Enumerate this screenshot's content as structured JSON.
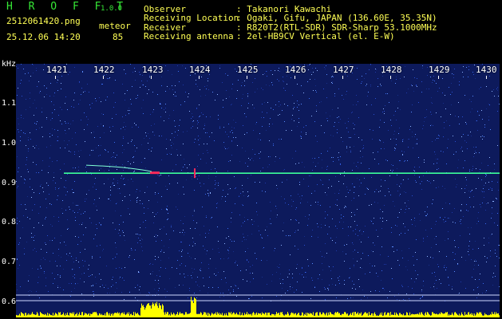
{
  "app": {
    "brand": "H R O F F T",
    "version": "1.0.0",
    "filename": "2512061420.png",
    "datetime": "25.12.06 14:20",
    "meteor_label": "meteor",
    "meteor_count": "85"
  },
  "info": [
    {
      "key": "Observer",
      "value": ": Takanori Kawachi"
    },
    {
      "key": "Receiving Location",
      "value": ": Ogaki, Gifu, JAPAN (136.60E, 35.35N)"
    },
    {
      "key": "Receiver",
      "value": ": R820T2(RTL-SDR) SDR-Sharp 53.1000MHz"
    },
    {
      "key": "Receiving antenna",
      "value": ": 2el-HB9CV Vertical (el. E-W)"
    }
  ],
  "spectrogram": {
    "y_unit": "kHz",
    "x_ticks": [
      "1421",
      "1422",
      "1423",
      "1424",
      "1425",
      "1426",
      "1427",
      "1428",
      "1429",
      "1430"
    ],
    "y_ticks": [
      "1.1",
      "1.0",
      "0.9",
      "0.8",
      "0.7",
      "0.6"
    ],
    "carrier_khz": 0.925,
    "colors": {
      "background": "#0d1a5c",
      "carrier": "#3cff9a",
      "echo": "#ff2a5a",
      "histogram": "#ffff00",
      "text": "#ffff55",
      "brand": "#36e836"
    }
  }
}
